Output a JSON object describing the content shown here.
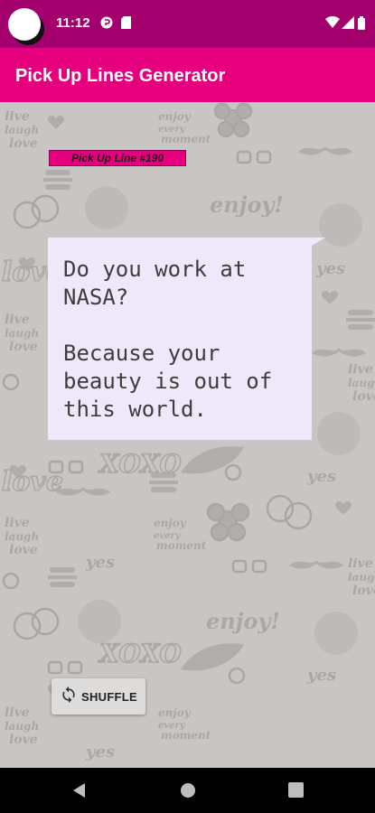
{
  "status_bar": {
    "time": "11:12",
    "icons": [
      "avatar-circle",
      "sync-icon",
      "sim-card-icon",
      "wifi-icon",
      "signal-icon",
      "battery-icon"
    ]
  },
  "app_bar": {
    "title": "Pick Up Lines Generator"
  },
  "line_card": {
    "tag": "Pick Up Line #190",
    "text": "Do you work at\nNASA?\n\nBecause your\nbeauty is out of\nthis world."
  },
  "actions": {
    "shuffle_label": "SHUFFLE",
    "shuffle_icon": "shuffle-refresh-icon"
  },
  "nav_bar": {
    "buttons": [
      "back",
      "home",
      "recents"
    ]
  },
  "colors": {
    "status_bar": "#a3006e",
    "app_bar": "#e6007e",
    "accent_tag": "#e6007e",
    "wallpaper": "#c8c6c4",
    "bubble": "#efe8fb"
  }
}
